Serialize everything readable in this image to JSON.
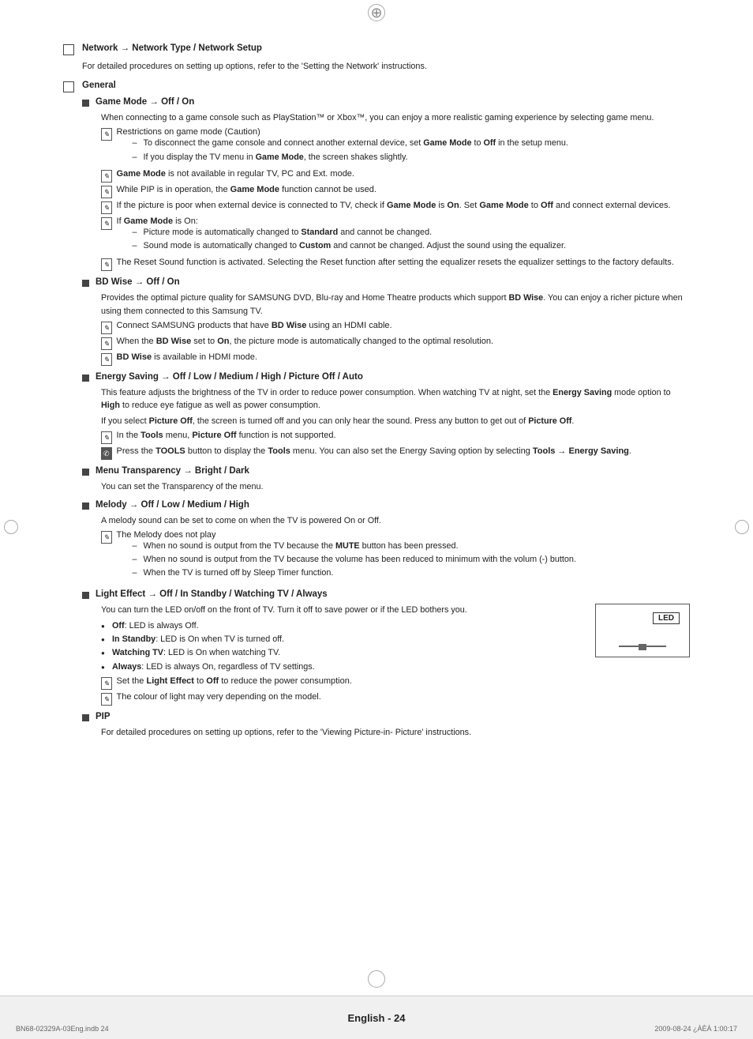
{
  "page": {
    "title": "English - 24",
    "footer_left": "BN68-02329A-03Eng.indb   24",
    "footer_right": "2009-08-24   ¿ÀÈÀ 1:00:17"
  },
  "sections": {
    "network": {
      "title": "Network → Network Type / Network Setup",
      "desc": "For detailed procedures on setting up options, refer to the 'Setting the Network' instructions."
    },
    "general": {
      "title": "General",
      "items": {
        "game_mode": {
          "title": "Game Mode → Off / On",
          "desc": "When connecting to a game console such as PlayStation™ or Xbox™, you can enjoy a more realistic gaming experience by selecting game menu.",
          "notes": [
            {
              "type": "note",
              "text": "Restrictions on game mode (Caution)",
              "dashes": [
                "To disconnect the game console and connect another external device, set Game Mode to Off in the setup menu.",
                "If you display the TV menu in Game Mode, the screen shakes slightly."
              ]
            },
            {
              "type": "note",
              "text": "Game Mode is not available in regular TV, PC and Ext. mode."
            },
            {
              "type": "note",
              "text": "While PIP is in operation, the Game Mode function cannot be used."
            },
            {
              "type": "note",
              "text": "If the picture is poor when external device is connected to TV, check if Game Mode is On. Set Game Mode to Off and connect external devices."
            },
            {
              "type": "note",
              "text": "If Game Mode is On:",
              "dashes": [
                "Picture mode is automatically changed to Standard and cannot be changed.",
                "Sound mode is automatically changed to Custom and cannot be changed. Adjust the sound using the equalizer."
              ]
            },
            {
              "type": "note",
              "text": "The Reset Sound function is activated. Selecting the Reset function after setting the equalizer resets the equalizer settings to the factory defaults."
            }
          ]
        },
        "bd_wise": {
          "title": "BD Wise → Off / On",
          "desc": "Provides the optimal picture quality for SAMSUNG DVD, Blu-ray and Home Theatre products which support BD Wise. You can enjoy a richer picture when using them connected to this Samsung TV.",
          "notes": [
            {
              "type": "note",
              "text": "Connect SAMSUNG products that have BD Wise using an HDMI cable."
            },
            {
              "type": "note",
              "text": "When the BD Wise set to On, the picture mode is automatically changed to the optimal resolution."
            },
            {
              "type": "note",
              "text": "BD Wise is available in HDMI mode."
            }
          ]
        },
        "energy_saving": {
          "title": "Energy Saving → Off / Low / Medium / High / Picture Off / Auto",
          "desc1": "This feature adjusts the brightness of the TV in order to reduce power consumption. When watching TV at night, set the Energy Saving mode option to High to reduce eye fatigue as well as power consumption.",
          "desc2": "If you select Picture Off, the screen is turned off and you can only hear the sound. Press any button to get out of Picture Off.",
          "notes": [
            {
              "type": "note",
              "text": "In the Tools menu, Picture Off function is not supported."
            },
            {
              "type": "remote",
              "text": "Press the TOOLS button to display the Tools menu. You can also set the Energy Saving option by selecting Tools → Energy Saving."
            }
          ]
        },
        "menu_transparency": {
          "title": "Menu Transparency → Bright / Dark",
          "desc": "You can set the Transparency of the menu."
        },
        "melody": {
          "title": "Melody → Off / Low / Medium / High",
          "desc": "A melody sound can be set to come on when the TV is powered On or Off.",
          "note_main": "The Melody does not play",
          "dashes": [
            "When no sound is output from the TV because the MUTE button has been pressed.",
            "When no sound is output from the TV because the volume has been reduced to minimum with the volum (-) button.",
            "When the TV is turned off by Sleep Timer function."
          ]
        },
        "light_effect": {
          "title": "Light Effect → Off / In Standby / Watching TV / Always",
          "desc": "You can turn the LED on/off on the front of TV. Turn it off to save power or if the LED bothers you.",
          "bullets": [
            {
              "label": "Off",
              "text": ": LED is always Off."
            },
            {
              "label": "In Standby",
              "text": ": LED is On when TV is turned off."
            },
            {
              "label": "Watching TV",
              "text": ": LED is On when watching TV."
            },
            {
              "label": "Always",
              "text": ": LED is always On, regardless of TV settings."
            }
          ],
          "notes": [
            {
              "type": "note",
              "text": "Set the Light Effect to Off to reduce the power consumption."
            },
            {
              "type": "note",
              "text": "The colour of light may very depending on the model."
            }
          ]
        },
        "pip": {
          "title": "PIP",
          "desc": "For detailed procedures on setting up options, refer to the 'Viewing Picture-in- Picture' instructions."
        }
      }
    }
  }
}
